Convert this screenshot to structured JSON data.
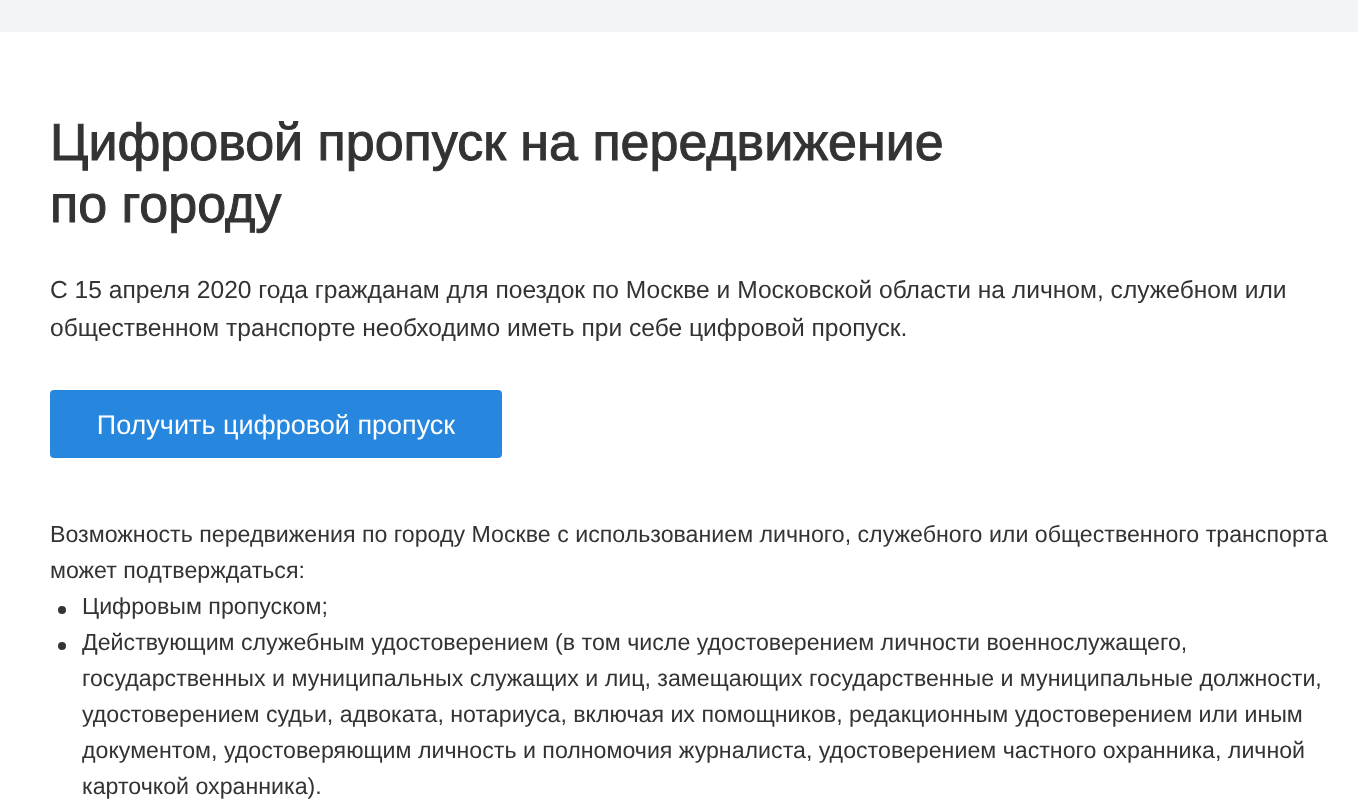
{
  "title": "Цифровой пропуск на передвижение по городу",
  "intro": "С 15 апреля 2020 года гражданам для поездок по Москве и Московской области на личном, служебном или общественном транспорте необходимо иметь при себе цифровой пропуск.",
  "button": {
    "label": "Получить цифровой пропуск"
  },
  "details": {
    "text": "Возможность передвижения по городу Москве с использованием личного, служебного или общественного транспорта может подтверждаться:",
    "items": [
      "Цифровым пропуском;",
      "Действующим служебным удостоверением (в том числе удостоверением личности военнослужащего, государственных и муниципальных служащих и лиц, замещающих государственные и муниципальные должности, удостоверением судьи, адвоката, нотариуса, включая их помощников, редакционным удостоверением или иным документом, удостоверяющим личность и полномочия журналиста, удостоверением частного охранника, личной карточкой охранника)."
    ]
  }
}
